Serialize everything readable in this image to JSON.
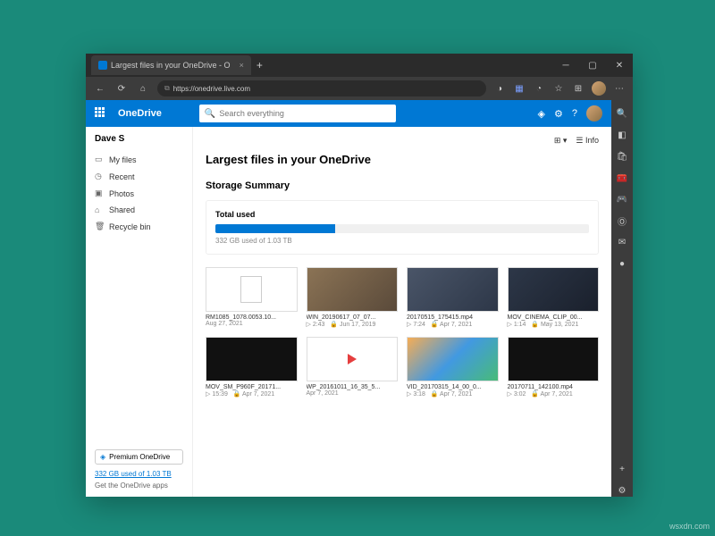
{
  "browser": {
    "tab_title": "Largest files in your OneDrive - O",
    "url": "https://onedrive.live.com"
  },
  "suite": {
    "brand": "OneDrive",
    "search_placeholder": "Search everything"
  },
  "toolbar": {
    "view_label": "",
    "info_label": "Info"
  },
  "user": {
    "name": "Dave S"
  },
  "nav": {
    "items": [
      {
        "label": "My files",
        "icon": "folder"
      },
      {
        "label": "Recent",
        "icon": "clock"
      },
      {
        "label": "Photos",
        "icon": "photo"
      },
      {
        "label": "Shared",
        "icon": "people"
      },
      {
        "label": "Recycle bin",
        "icon": "trash"
      }
    ],
    "premium_label": "Premium OneDrive",
    "storage_link": "332 GB used of 1.03 TB",
    "get_apps": "Get the OneDrive apps"
  },
  "page": {
    "title": "Largest files in your OneDrive",
    "section": "Storage Summary",
    "storage": {
      "label": "Total used",
      "used_text": "332 GB used of 1.03 TB",
      "percent": 32
    }
  },
  "files": [
    {
      "name": "RM1085_1078.0053.10...",
      "meta": "Aug 27, 2021",
      "kind": "doc"
    },
    {
      "name": "WIN_20190617_07_07...",
      "dur": "2:43",
      "meta": "Jun 17, 2019",
      "kind": "vid1"
    },
    {
      "name": "20170515_175415.mp4",
      "dur": "7:24",
      "meta": "Apr 7, 2021",
      "kind": "vid2"
    },
    {
      "name": "MOV_CINEMA_CLIP_00...",
      "dur": "1:14",
      "meta": "May 13, 2021",
      "kind": "vid3"
    },
    {
      "name": "MOV_SM_P960F_20171...",
      "dur": "15:39",
      "meta": "Apr 7, 2021",
      "kind": "black"
    },
    {
      "name": "WP_20161011_16_35_5...",
      "meta": "Apr 7, 2021",
      "kind": "play"
    },
    {
      "name": "VID_20170315_14_00_0...",
      "dur": "3:18",
      "meta": "Apr 7, 2021",
      "kind": "colorful"
    },
    {
      "name": "20170711_142100.mp4",
      "dur": "3:02",
      "meta": "Apr 7, 2021",
      "kind": "black"
    }
  ],
  "watermark": "wsxdn.com"
}
